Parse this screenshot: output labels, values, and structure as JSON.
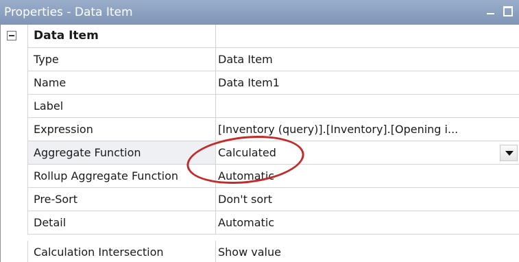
{
  "window": {
    "title": "Properties - Data Item",
    "minimize_icon": "minimize-icon",
    "maximize_icon": "maximize-icon"
  },
  "category": {
    "label": "Data Item",
    "expanded": true,
    "toggle_icon": "collapse-minus-icon"
  },
  "properties": [
    {
      "name": "Type",
      "value": "Data Item"
    },
    {
      "name": "Name",
      "value": "Data Item1"
    },
    {
      "name": "Label",
      "value": ""
    },
    {
      "name": "Expression",
      "value": "[Inventory (query)].[Inventory].[Opening i..."
    },
    {
      "name": "Aggregate Function",
      "value": "Calculated",
      "selected": true,
      "dropdown_icon": "dropdown-arrow-icon"
    },
    {
      "name": "Rollup Aggregate Function",
      "value": "Automatic"
    },
    {
      "name": "Pre-Sort",
      "value": "Don't sort"
    },
    {
      "name": "Detail",
      "value": "Automatic"
    },
    {
      "name": "Calculation Intersection",
      "value": "Show value"
    }
  ],
  "annotation": {
    "color": "#c42a2a",
    "shape": "ellipse"
  }
}
